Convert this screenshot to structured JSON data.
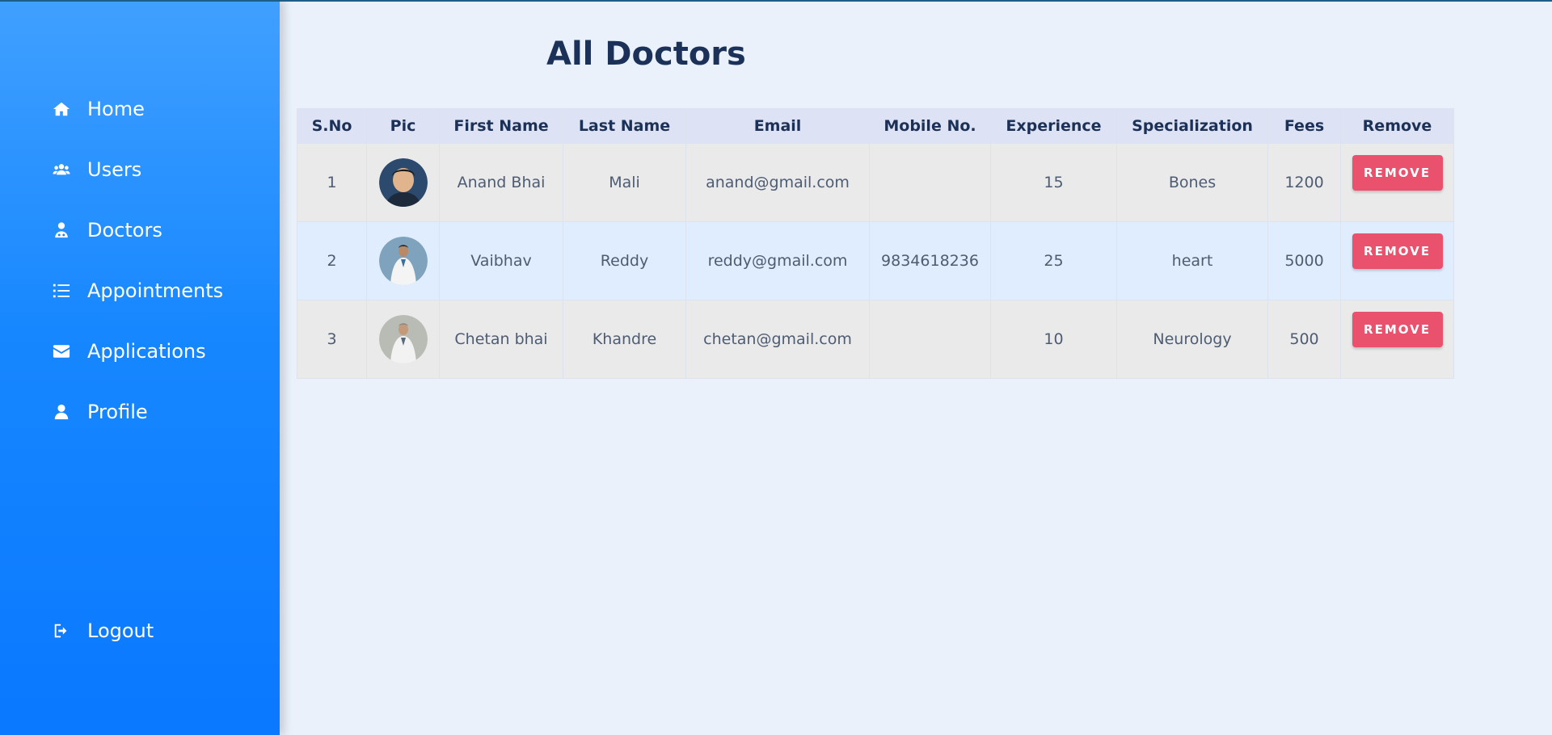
{
  "sidebar": {
    "items": [
      {
        "label": "Home",
        "icon": "home-icon"
      },
      {
        "label": "Users",
        "icon": "users-icon"
      },
      {
        "label": "Doctors",
        "icon": "doctor-icon"
      },
      {
        "label": "Appointments",
        "icon": "list-icon"
      },
      {
        "label": "Applications",
        "icon": "envelope-icon"
      },
      {
        "label": "Profile",
        "icon": "user-icon"
      }
    ],
    "logout": {
      "label": "Logout",
      "icon": "logout-icon"
    }
  },
  "main": {
    "title": "All Doctors",
    "table": {
      "headers": [
        "S.No",
        "Pic",
        "First Name",
        "Last Name",
        "Email",
        "Mobile No.",
        "Experience",
        "Specialization",
        "Fees",
        "Remove"
      ],
      "rows": [
        {
          "sno": "1",
          "first_name": "Anand Bhai",
          "last_name": "Mali",
          "email": "anand@gmail.com",
          "mobile": "",
          "experience": "15",
          "specialization": "Bones",
          "fees": "1200",
          "remove_label": "REMOVE"
        },
        {
          "sno": "2",
          "first_name": "Vaibhav",
          "last_name": "Reddy",
          "email": "reddy@gmail.com",
          "mobile": "9834618236",
          "experience": "25",
          "specialization": "heart",
          "fees": "5000",
          "remove_label": "REMOVE"
        },
        {
          "sno": "3",
          "first_name": "Chetan bhai",
          "last_name": "Khandre",
          "email": "chetan@gmail.com",
          "mobile": "",
          "experience": "10",
          "specialization": "Neurology",
          "fees": "500",
          "remove_label": "REMOVE"
        }
      ]
    }
  },
  "colors": {
    "sidebar_top": "#40a0ff",
    "sidebar_bottom": "#0a78ff",
    "background": "#eaf1fb",
    "title": "#1b3158",
    "remove_button": "#e9516d"
  }
}
